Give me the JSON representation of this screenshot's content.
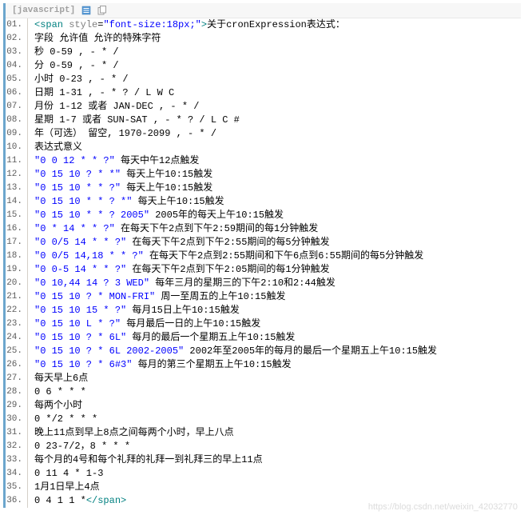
{
  "header": {
    "lang_label": "[javascript]",
    "icon_view": "view-icon",
    "icon_copy": "copy-icon"
  },
  "watermark": "https://blog.csdn.net/weixin_42032770",
  "lines": [
    {
      "n": "01.",
      "segs": [
        {
          "t": "<span",
          "c": "tag"
        },
        {
          "t": " "
        },
        {
          "t": "style",
          "c": "attr"
        },
        {
          "t": "="
        },
        {
          "t": "\"font-size:18px;\"",
          "c": "val"
        },
        {
          "t": ">",
          "c": "tag"
        },
        {
          "t": "关于cronExpression表达式："
        }
      ]
    },
    {
      "n": "02.",
      "segs": [
        {
          "t": "字段 允许值 允许的特殊字符"
        }
      ]
    },
    {
      "n": "03.",
      "segs": [
        {
          "t": "秒 0-59 , - * /"
        }
      ]
    },
    {
      "n": "04.",
      "segs": [
        {
          "t": "分 0-59 , - * /"
        }
      ]
    },
    {
      "n": "05.",
      "segs": [
        {
          "t": "小时 0-23 , - * /"
        }
      ]
    },
    {
      "n": "06.",
      "segs": [
        {
          "t": "日期 1-31 , - * ? / L W C"
        }
      ]
    },
    {
      "n": "07.",
      "segs": [
        {
          "t": "月份 1-12 或者 JAN-DEC , - * /"
        }
      ]
    },
    {
      "n": "08.",
      "segs": [
        {
          "t": "星期 1-7 或者 SUN-SAT , - * ? / L C #"
        }
      ]
    },
    {
      "n": "09.",
      "segs": [
        {
          "t": "年（可选） 留空, 1970-2099 , - * /"
        }
      ]
    },
    {
      "n": "10.",
      "segs": [
        {
          "t": "表达式意义"
        }
      ]
    },
    {
      "n": "11.",
      "segs": [
        {
          "t": "\"0 0 12 * * ?\"",
          "c": "str"
        },
        {
          "t": " 每天中午12点触发"
        }
      ]
    },
    {
      "n": "12.",
      "segs": [
        {
          "t": "\"0 15 10 ? * *\"",
          "c": "str"
        },
        {
          "t": " 每天上午10:15触发"
        }
      ]
    },
    {
      "n": "13.",
      "segs": [
        {
          "t": "\"0 15 10 * * ?\"",
          "c": "str"
        },
        {
          "t": " 每天上午10:15触发"
        }
      ]
    },
    {
      "n": "14.",
      "segs": [
        {
          "t": "\"0 15 10 * * ? *\"",
          "c": "str"
        },
        {
          "t": " 每天上午10:15触发"
        }
      ]
    },
    {
      "n": "15.",
      "segs": [
        {
          "t": "\"0 15 10 * * ? 2005\"",
          "c": "str"
        },
        {
          "t": " 2005年的每天上午10:15触发"
        }
      ]
    },
    {
      "n": "16.",
      "segs": [
        {
          "t": "\"0 * 14 * * ?\"",
          "c": "str"
        },
        {
          "t": " 在每天下午2点到下午2:59期间的每1分钟触发"
        }
      ]
    },
    {
      "n": "17.",
      "segs": [
        {
          "t": "\"0 0/5 14 * * ?\"",
          "c": "str"
        },
        {
          "t": " 在每天下午2点到下午2:55期间的每5分钟触发"
        }
      ]
    },
    {
      "n": "18.",
      "segs": [
        {
          "t": "\"0 0/5 14,18 * * ?\"",
          "c": "str"
        },
        {
          "t": " 在每天下午2点到2:55期间和下午6点到6:55期间的每5分钟触发"
        }
      ]
    },
    {
      "n": "19.",
      "segs": [
        {
          "t": "\"0 0-5 14 * * ?\"",
          "c": "str"
        },
        {
          "t": " 在每天下午2点到下午2:05期间的每1分钟触发"
        }
      ]
    },
    {
      "n": "20.",
      "segs": [
        {
          "t": "\"0 10,44 14 ? 3 WED\"",
          "c": "str"
        },
        {
          "t": " 每年三月的星期三的下午2:10和2:44触发"
        }
      ]
    },
    {
      "n": "21.",
      "segs": [
        {
          "t": "\"0 15 10 ? * MON-FRI\"",
          "c": "str"
        },
        {
          "t": " 周一至周五的上午10:15触发"
        }
      ]
    },
    {
      "n": "22.",
      "segs": [
        {
          "t": "\"0 15 10 15 * ?\"",
          "c": "str"
        },
        {
          "t": " 每月15日上午10:15触发"
        }
      ]
    },
    {
      "n": "23.",
      "segs": [
        {
          "t": "\"0 15 10 L * ?\"",
          "c": "str"
        },
        {
          "t": " 每月最后一日的上午10:15触发"
        }
      ]
    },
    {
      "n": "24.",
      "segs": [
        {
          "t": "\"0 15 10 ? * 6L\"",
          "c": "str"
        },
        {
          "t": " 每月的最后一个星期五上午10:15触发"
        }
      ]
    },
    {
      "n": "25.",
      "segs": [
        {
          "t": "\"0 15 10 ? * 6L 2002-2005\"",
          "c": "str"
        },
        {
          "t": " 2002年至2005年的每月的最后一个星期五上午10:15触发"
        }
      ]
    },
    {
      "n": "26.",
      "segs": [
        {
          "t": "\"0 15 10 ? * 6#3\"",
          "c": "str"
        },
        {
          "t": " 每月的第三个星期五上午10:15触发"
        }
      ]
    },
    {
      "n": "27.",
      "segs": [
        {
          "t": "每天早上6点"
        }
      ]
    },
    {
      "n": "28.",
      "segs": [
        {
          "t": "0 6 * * *"
        }
      ]
    },
    {
      "n": "29.",
      "segs": [
        {
          "t": "每两个小时"
        }
      ]
    },
    {
      "n": "30.",
      "segs": [
        {
          "t": "0 */2 * * *"
        }
      ]
    },
    {
      "n": "31.",
      "segs": [
        {
          "t": "晚上11点到早上8点之间每两个小时，早上八点"
        }
      ]
    },
    {
      "n": "32.",
      "segs": [
        {
          "t": "0 23-7/2，8 * * *"
        }
      ]
    },
    {
      "n": "33.",
      "segs": [
        {
          "t": "每个月的4号和每个礼拜的礼拜一到礼拜三的早上11点"
        }
      ]
    },
    {
      "n": "34.",
      "segs": [
        {
          "t": "0 11 4 * 1-3"
        }
      ]
    },
    {
      "n": "35.",
      "segs": [
        {
          "t": "1月1日早上4点"
        }
      ]
    },
    {
      "n": "36.",
      "segs": [
        {
          "t": "0 4 1 1 *"
        },
        {
          "t": "</span>",
          "c": "tag"
        }
      ]
    }
  ]
}
